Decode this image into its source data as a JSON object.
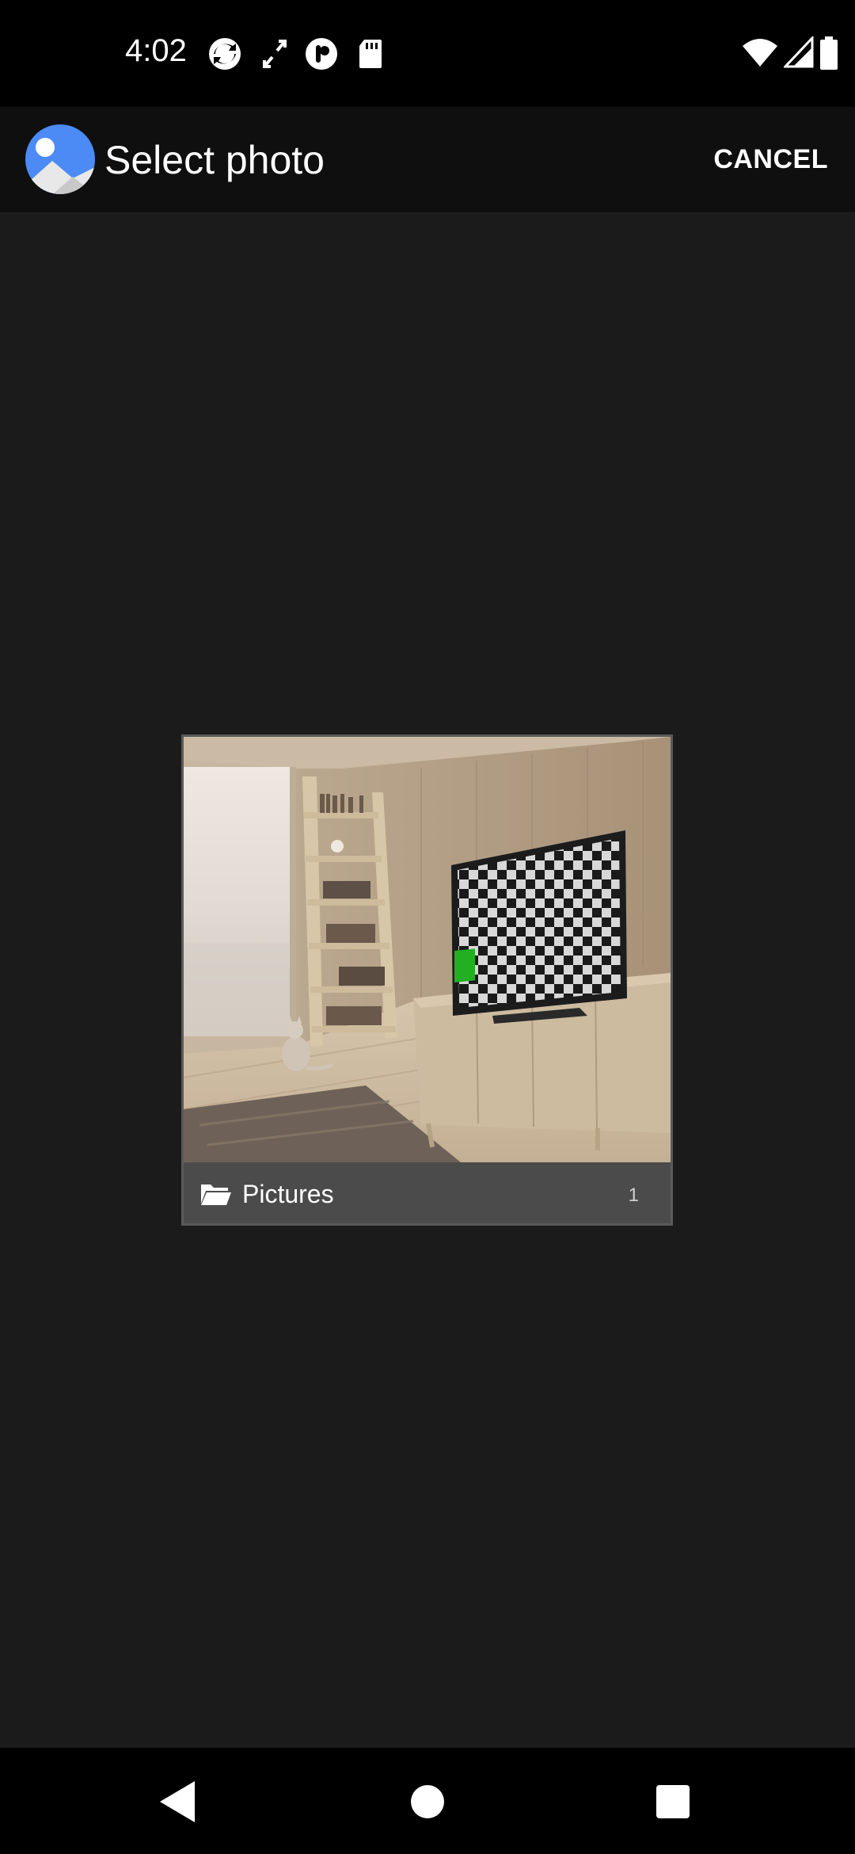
{
  "status_bar": {
    "time": "4:02",
    "left_icons": [
      "sync-icon",
      "rotate-icon",
      "pocket-icon",
      "sd-card-icon"
    ],
    "right_icons": [
      "wifi-icon",
      "cell-signal-icon",
      "battery-icon"
    ]
  },
  "app_bar": {
    "title": "Select photo",
    "cancel_label": "CANCEL",
    "logo_icon": "photos-app-icon"
  },
  "albums": [
    {
      "name": "Pictures",
      "count": "1",
      "icon": "folder-icon"
    }
  ],
  "nav_bar": {
    "buttons": [
      "back-icon",
      "home-icon",
      "recents-icon"
    ]
  },
  "colors": {
    "background": "#1b1b1b",
    "app_bar": "#0f0f0f",
    "status_bar": "#000000",
    "accent": "#4c8bf5"
  }
}
